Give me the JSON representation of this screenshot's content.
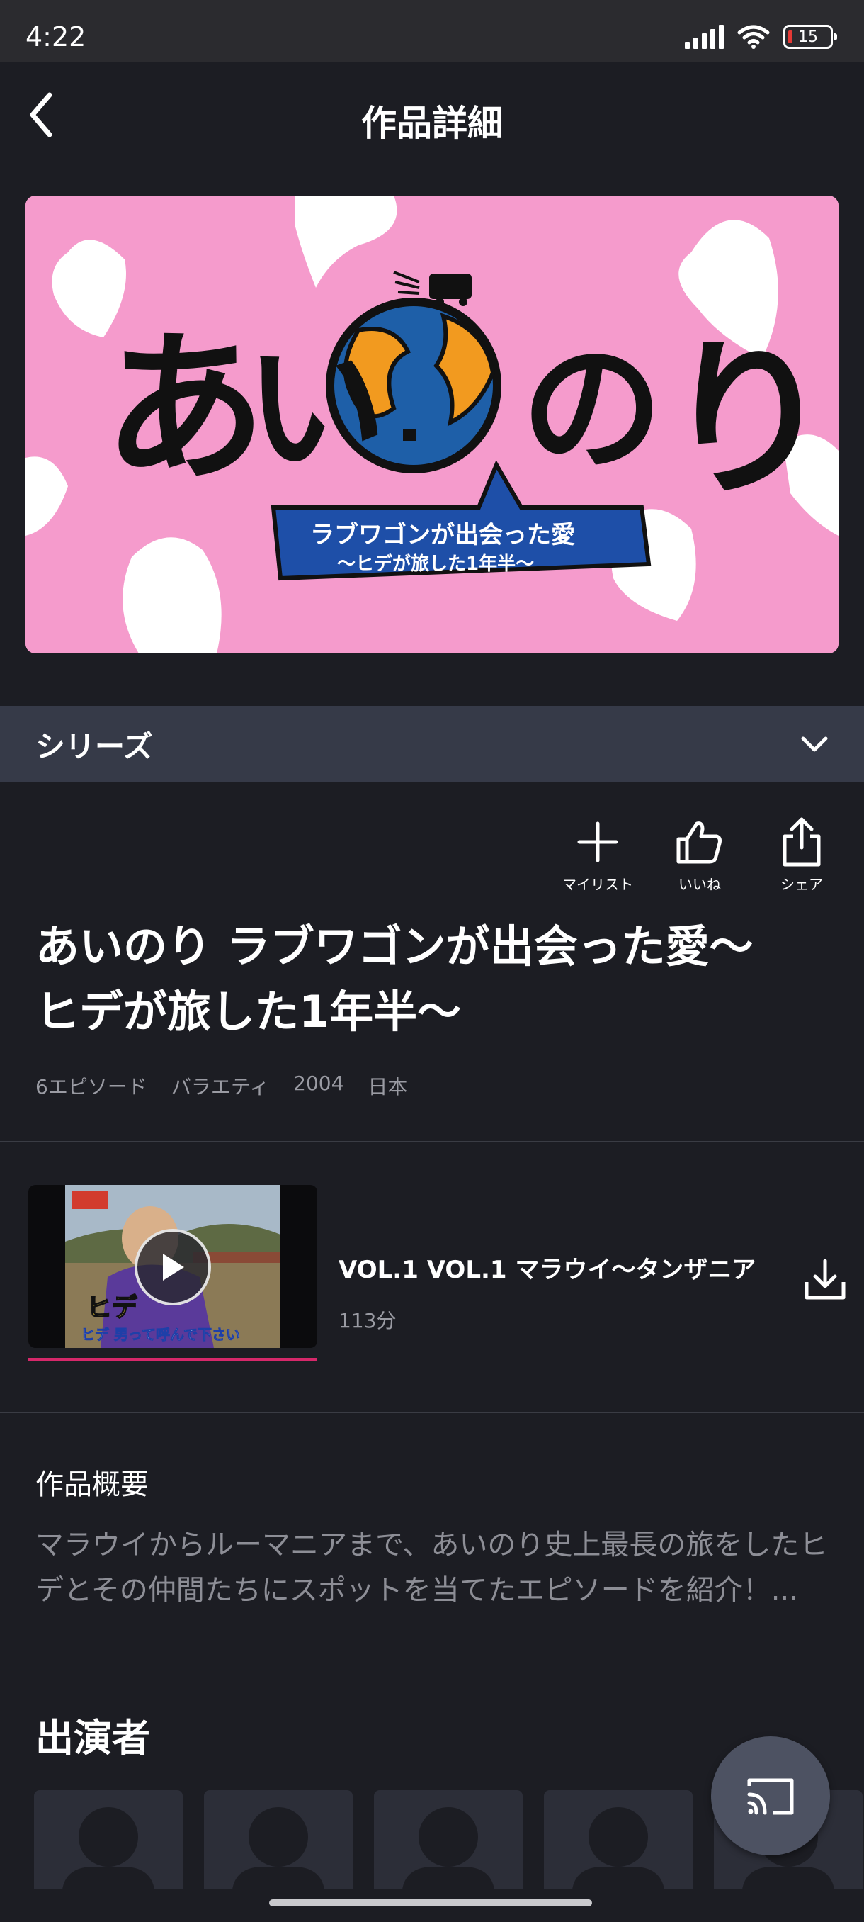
{
  "status_bar": {
    "time": "4:22",
    "battery": "15"
  },
  "header": {
    "title": "作品詳細"
  },
  "hero": {
    "logo_text": [
      "あ",
      "い",
      "の",
      "り"
    ],
    "banner_line1": "ラブワゴンが出会った愛",
    "banner_line2": "〜ヒデが旅した1年半〜"
  },
  "series": {
    "label": "シリーズ"
  },
  "actions": [
    {
      "label": "マイリスト",
      "icon": "plus-icon"
    },
    {
      "label": "いいね",
      "icon": "thumbs-up-icon"
    },
    {
      "label": "シェア",
      "icon": "share-icon"
    }
  ],
  "show": {
    "title_line1": "あいのり ラブワゴンが出会った愛〜",
    "title_line2": "ヒデが旅した1年半〜",
    "meta": [
      "6エピソード",
      "バラエティ",
      "2004",
      "日本"
    ]
  },
  "episodes": [
    {
      "title": "VOL.1 VOL.1 マラウイ〜タンザニア",
      "duration": "113分",
      "progress": 1.0,
      "thumb_caption": "ヒデ",
      "thumb_subcaption": "ヒデ 男って呼んで下さい"
    }
  ],
  "synopsis": {
    "heading": "作品概要",
    "text": "マラウイからルーマニアまで、あいのり史上最長の旅をしたヒデとその仲間たちにスポットを当てたエピソードを紹介！..."
  },
  "cast": {
    "heading": "出演者",
    "count": 5
  },
  "colors": {
    "background": "#1c1d23",
    "series_bar": "#363a48",
    "accent": "#d6286a",
    "hero_pink": "#f59bcc"
  }
}
